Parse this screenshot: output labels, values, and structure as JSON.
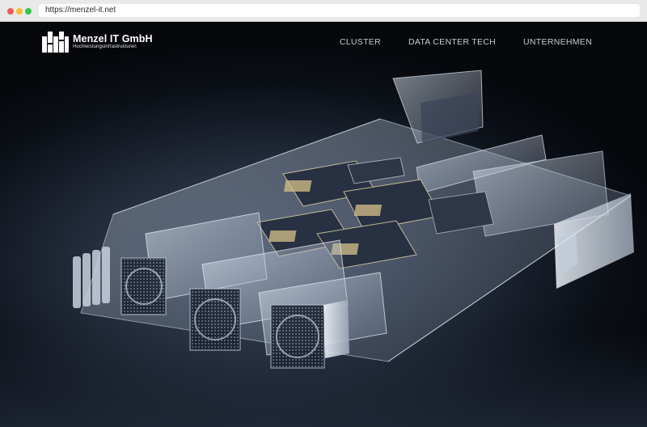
{
  "browser": {
    "url": "https://menzel-it.net"
  },
  "header": {
    "logo": {
      "name": "Menzel IT GmbH",
      "tagline": "Hochleistungsinfrastrukturen"
    },
    "nav": [
      {
        "label": "CLUSTER"
      },
      {
        "label": "DATA CENTER TECH"
      },
      {
        "label": "UNTERNEHMEN"
      }
    ]
  },
  "hero": {
    "image": "server-exploded-render-illustration"
  },
  "colors": {
    "background": "#05070b",
    "chrome": "#e9e9ea",
    "nav_text": "#c9ccd2",
    "logo_text": "#ffffff"
  }
}
